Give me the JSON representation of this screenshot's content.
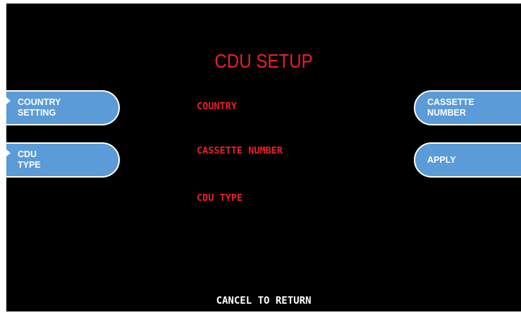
{
  "screen": {
    "title": "CDU SETUP",
    "footer": "CANCEL TO RETURN"
  },
  "labels": {
    "country": "COUNTRY",
    "cassette_number": "CASSETTE NUMBER",
    "cdu_type": "CDU TYPE"
  },
  "buttons": {
    "country_setting": {
      "line1": "COUNTRY",
      "line2": "SETTING"
    },
    "cdu_type": {
      "line1": "CDU",
      "line2": "TYPE"
    },
    "cassette_number": {
      "line1": "CASSETTE",
      "line2": "NUMBER"
    },
    "apply": {
      "line1": "APPLY"
    }
  },
  "colors": {
    "background": "#000000",
    "title": "#e8202a",
    "button_fill": "#5a9bd8",
    "footer_text": "#ffffff"
  }
}
